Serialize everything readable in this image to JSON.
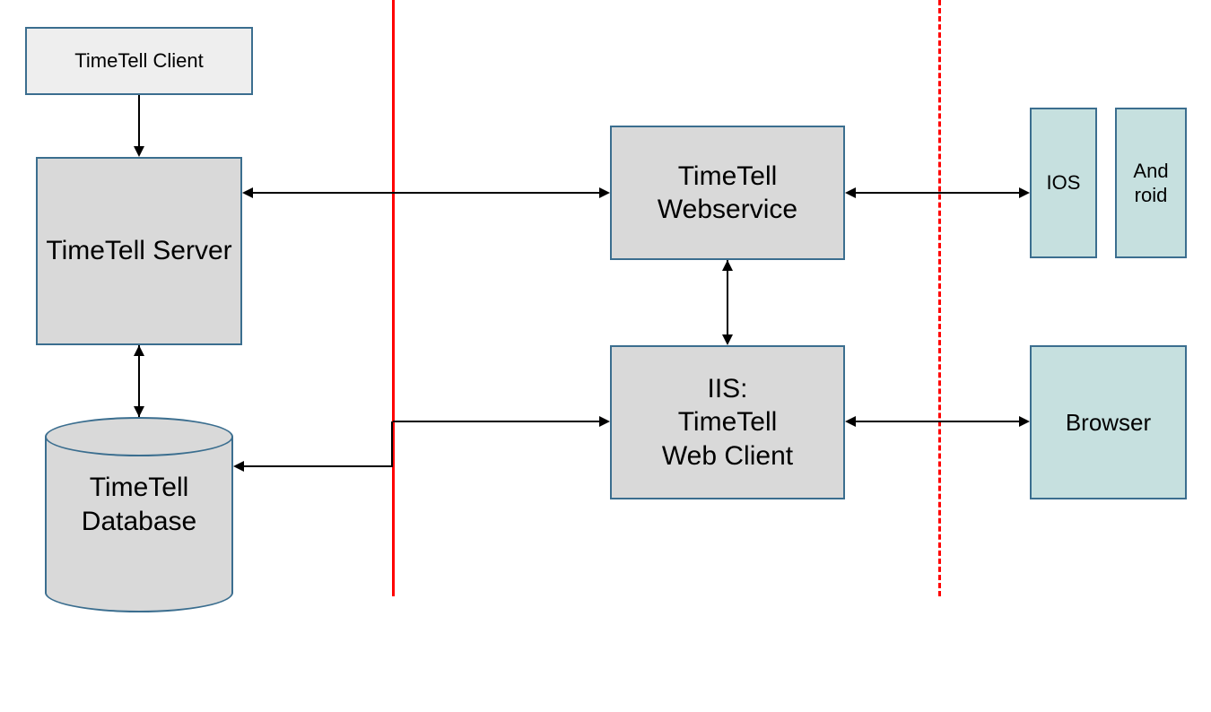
{
  "nodes": {
    "client": "TimeTell Client",
    "server": "TimeTell Server",
    "database": "TimeTell Database",
    "webservice": "TimeTell Webservice",
    "webclient": "IIS:\nTimeTell\nWeb Client",
    "ios": "IOS",
    "android": "And\nroid",
    "browser": "Browser"
  }
}
